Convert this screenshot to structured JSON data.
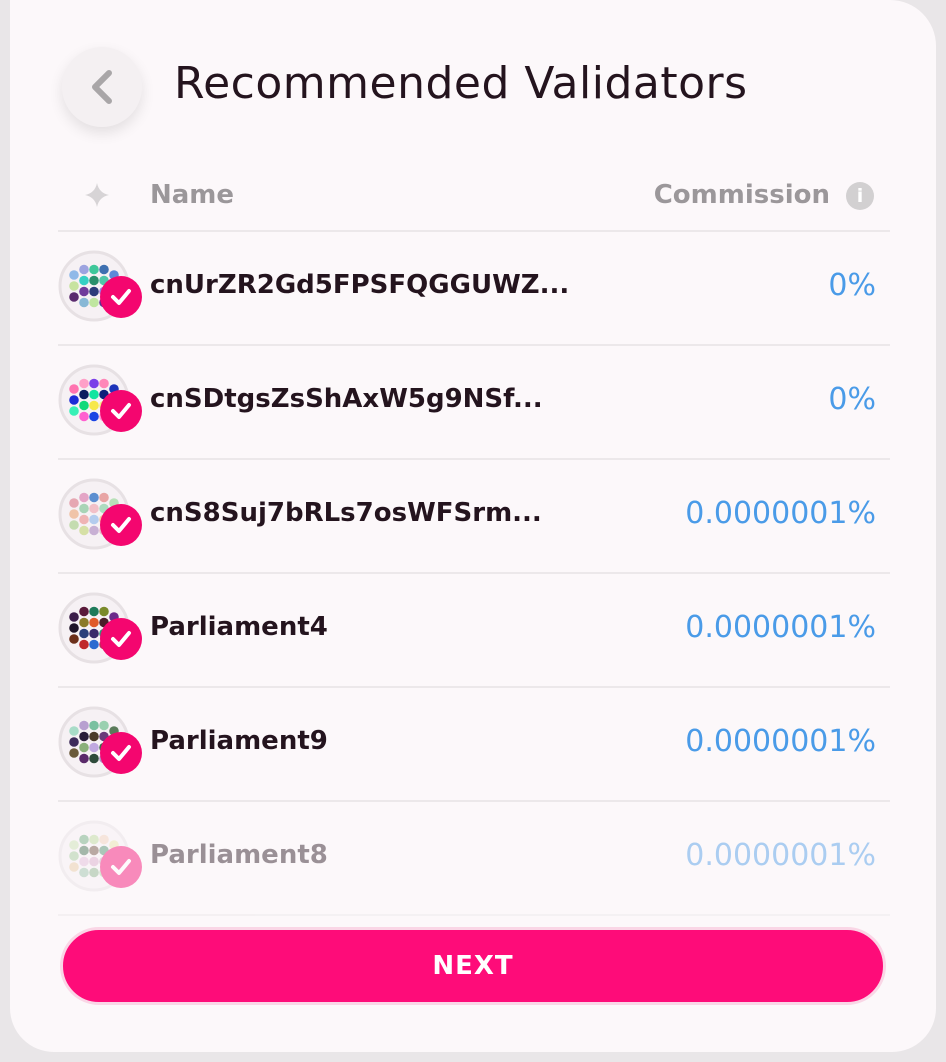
{
  "header": {
    "title": "Recommended Validators"
  },
  "table": {
    "col_name": "Name",
    "col_commission": "Commission",
    "info_glyph": "i"
  },
  "validators": [
    {
      "name": "cnUrZR2Gd5FPSFQGGUWZ...",
      "commission": "0%",
      "selected": true,
      "colors": [
        "#8fb9e8",
        "#c7e39f",
        "#5a2b6e",
        "#9da4e0",
        "#36d0c4",
        "#6f3b9c",
        "#88b8d6",
        "#3fc79a",
        "#2a8f6b",
        "#2d3c7a",
        "#bfe6a0",
        "#3e6fb0",
        "#4fc6a8",
        "#9b7ae2",
        "#5f2f91",
        "#5b8ad9",
        "#46b5c3",
        "#7a3f8f"
      ]
    },
    {
      "name": "cnSDtgsZsShAxW5g9NSf...",
      "commission": "0%",
      "selected": true,
      "colors": [
        "#ff73b0",
        "#1b2bd6",
        "#38f0b6",
        "#ffa0c8",
        "#0d1a5f",
        "#10d97a",
        "#ff5fd0",
        "#7b3fe8",
        "#12e5a0",
        "#f6e84a",
        "#1a44e4",
        "#ff86b8",
        "#0e1f7a",
        "#f4f080",
        "#ff90d2",
        "#1c33b9",
        "#38ec8e",
        "#e0d0ff"
      ]
    },
    {
      "name": "cnS8Suj7bRLs7osWFSrm...",
      "commission": "0.0000001%",
      "selected": true,
      "colors": [
        "#e6a7b2",
        "#f0c4a8",
        "#c4dcb0",
        "#e4a5c6",
        "#a8d4b6",
        "#efb4b4",
        "#d6e0a6",
        "#5c8ed0",
        "#f2c0c8",
        "#b4ccee",
        "#c8b0d4",
        "#e8a4a4",
        "#acdcc0",
        "#f4c8a0",
        "#e8b8c8",
        "#b8e0b8",
        "#d89cb8",
        "#f0d0b8"
      ]
    },
    {
      "name": "Parliament4",
      "commission": "0.0000001%",
      "selected": true,
      "colors": [
        "#3c1e4a",
        "#1e1428",
        "#6b2f1a",
        "#5a1a3a",
        "#8a7a2a",
        "#2a3f7a",
        "#c0282a",
        "#1e7a5a",
        "#e05a2a",
        "#3a2a6a",
        "#2a6ad0",
        "#7a8a2a",
        "#4a1e2a",
        "#2a9a7a",
        "#c02a5a",
        "#6a2a8a",
        "#1e5a3a",
        "#8a3a1a"
      ]
    },
    {
      "name": "Parliament9",
      "commission": "0.0000001%",
      "selected": true,
      "colors": [
        "#a8dcc8",
        "#3c2a5a",
        "#6a5a3a",
        "#b8a0d0",
        "#2a1e3a",
        "#8ab07a",
        "#5a2a6a",
        "#7ac0a0",
        "#4a3a2a",
        "#c0a8e0",
        "#2e4a3a",
        "#9ad0b0",
        "#6a3a7a",
        "#3a6a4a",
        "#b090c8",
        "#5a7a5a",
        "#8a6ab0",
        "#3a2a4a"
      ]
    },
    {
      "name": "Parliament8",
      "commission": "0.0000001%",
      "selected": true,
      "colors": [
        "#c8e0b0",
        "#a0c898",
        "#e8c8a0",
        "#68a878",
        "#3a6a4a",
        "#e0b8d8",
        "#98c0a8",
        "#b8d898",
        "#6a4a3a",
        "#d8a8c8",
        "#88b088",
        "#f0d0b8",
        "#4a8a6a",
        "#c8a0b8",
        "#a8d0a0",
        "#e8e0a8",
        "#7a5a6a",
        "#b0c8e0"
      ]
    }
  ],
  "footer": {
    "next_label": "NEXT"
  },
  "colors": {
    "accent": "#fe0c79",
    "check": "#f4066f",
    "commission_text": "#4a9be8",
    "title_text": "#24141e",
    "header_text": "#9b979a"
  }
}
